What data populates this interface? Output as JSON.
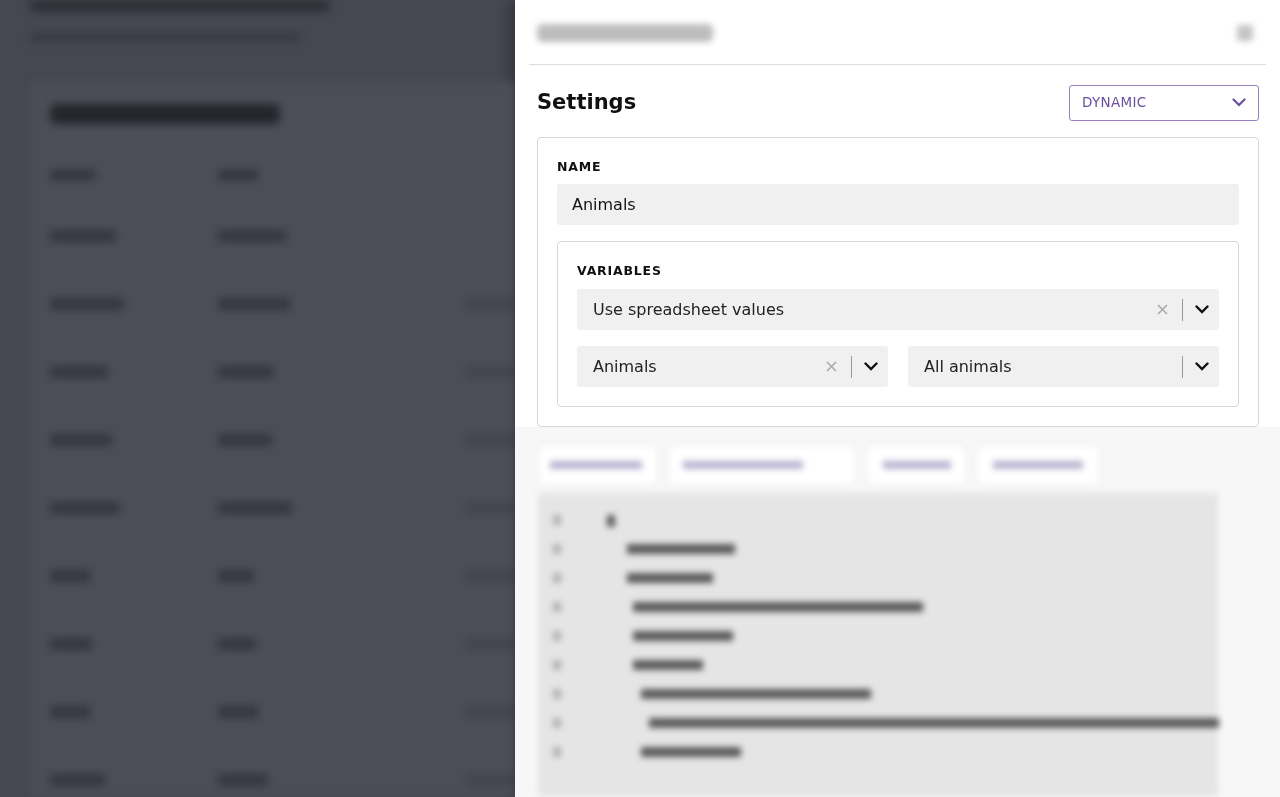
{
  "settings": {
    "title": "Settings",
    "mode": "DYNAMIC"
  },
  "name_field": {
    "label": "NAME",
    "value": "Animals"
  },
  "variables": {
    "label": "VARIABLES",
    "source": {
      "value": "Use spreadsheet values",
      "clearable": true
    },
    "selects": [
      {
        "value": "Animals",
        "clearable": true
      },
      {
        "value": "All animals",
        "clearable": false
      }
    ]
  }
}
